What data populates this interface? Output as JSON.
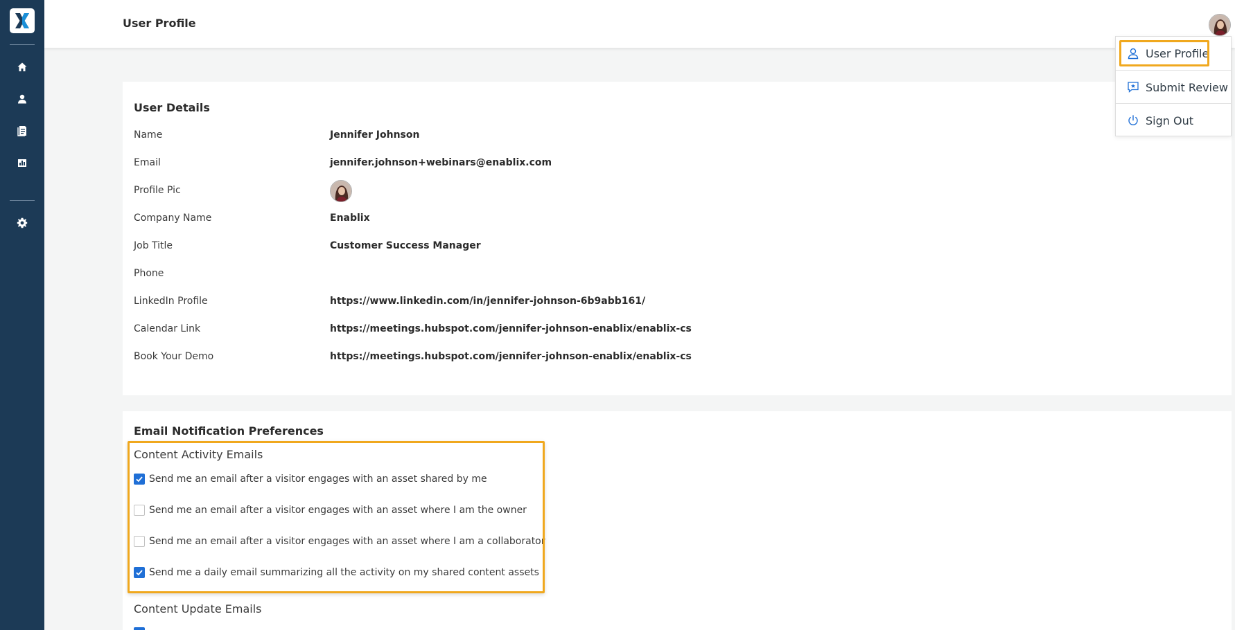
{
  "header": {
    "title": "User Profile"
  },
  "sidebar": {
    "items": [
      {
        "icon": "home-icon"
      },
      {
        "icon": "user-icon"
      },
      {
        "icon": "document-icon"
      },
      {
        "icon": "bar-chart-icon"
      },
      {
        "icon": "gear-icon"
      }
    ]
  },
  "dropdown": {
    "items": [
      {
        "label": "User Profile",
        "icon": "user-outline-icon"
      },
      {
        "label": "Submit Review",
        "icon": "review-star-icon"
      },
      {
        "label": "Sign Out",
        "icon": "power-icon"
      }
    ]
  },
  "user_details": {
    "title": "User Details",
    "rows": [
      {
        "label": "Name",
        "value": "Jennifer Johnson"
      },
      {
        "label": "Email",
        "value": "jennifer.johnson+webinars@enablix.com"
      },
      {
        "label": "Profile Pic",
        "value": ""
      },
      {
        "label": "Company Name",
        "value": "Enablix"
      },
      {
        "label": "Job Title",
        "value": "Customer Success Manager"
      },
      {
        "label": "Phone",
        "value": ""
      },
      {
        "label": "LinkedIn Profile",
        "value": "https://www.linkedin.com/in/jennifer-johnson-6b9abb161/"
      },
      {
        "label": "Calendar Link",
        "value": "https://meetings.hubspot.com/jennifer-johnson-enablix/enablix-cs"
      },
      {
        "label": "Book Your Demo",
        "value": "https://meetings.hubspot.com/jennifer-johnson-enablix/enablix-cs"
      }
    ]
  },
  "email_prefs": {
    "title": "Email Notification Preferences",
    "content_activity": {
      "title": "Content Activity Emails",
      "options": [
        {
          "label": "Send me an email after a visitor engages with an asset shared by me",
          "checked": true
        },
        {
          "label": "Send me an email after a visitor engages with an asset where I am the owner",
          "checked": false
        },
        {
          "label": "Send me an email after a visitor engages with an asset where I am a collaborator",
          "checked": false
        },
        {
          "label": "Send me a daily email summarizing all the activity on my shared content assets",
          "checked": true
        }
      ]
    },
    "content_update": {
      "title": "Content Update Emails"
    }
  },
  "colors": {
    "sidebar": "#1c3a56",
    "accent": "#1f6fd6",
    "highlight": "#f0a81e",
    "logo_x": "#1a8fd8"
  }
}
